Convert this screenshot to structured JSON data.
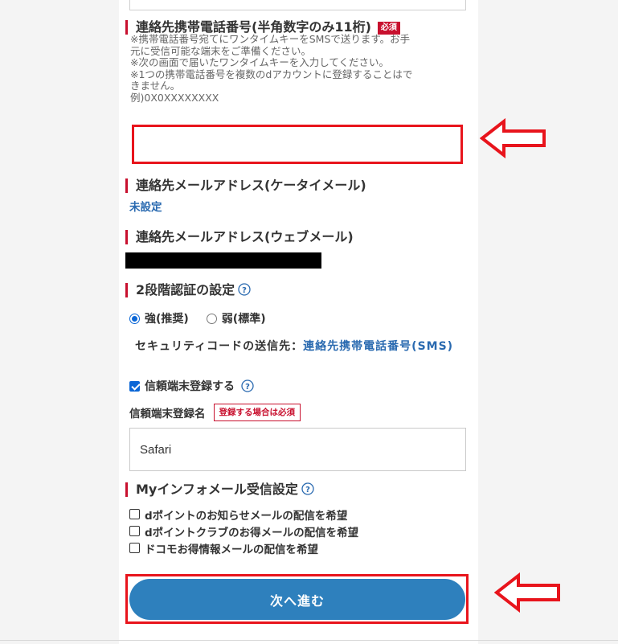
{
  "phone_section": {
    "title": "連絡先携帯電話番号(半角数字のみ11桁)",
    "required_badge": "必須",
    "notes": [
      "※携帯電話番号宛てにワンタイムキーをSMSで送ります。お手",
      "元に受信可能な端末をご準備ください。",
      "※次の画面で届いたワンタイムキーを入力してください。",
      "※1つの携帯電話番号を複数のdアカウントに登録することはで",
      "きません。",
      "例)0X0XXXXXXXX"
    ],
    "input_value": ""
  },
  "mobile_mail": {
    "title": "連絡先メールアドレス(ケータイメール)",
    "value": "未設定"
  },
  "web_mail": {
    "title": "連絡先メールアドレス(ウェブメール)"
  },
  "two_factor": {
    "title": "2段階認証の設定",
    "options": [
      {
        "label": "強(推奨)",
        "selected": true
      },
      {
        "label": "弱(標準)",
        "selected": false
      }
    ],
    "security_code_label": "セキュリティコードの送信先：",
    "security_code_value": "連絡先携帯電話番号(SMS)",
    "trusted_device_checkbox": "信頼端末登録する",
    "trusted_device_checked": true,
    "trusted_name_label": "信頼端末登録名",
    "trusted_name_badge": "登録する場合は必須",
    "trusted_name_value": "Safari"
  },
  "my_info": {
    "title": "Myインフォメール受信設定",
    "items": [
      "dポイントのお知らせメールの配信を希望",
      "dポイントクラブのお得メールの配信を希望",
      "ドコモお得情報メールの配信を希望"
    ]
  },
  "next_button": "次へ進む",
  "colors": {
    "accent_red": "#c8102e",
    "highlight_red": "#e8141c",
    "link_blue": "#2a6ab0",
    "button_blue": "#2e80bd"
  },
  "icons": [
    "help-icon",
    "arrow-left-icon"
  ]
}
